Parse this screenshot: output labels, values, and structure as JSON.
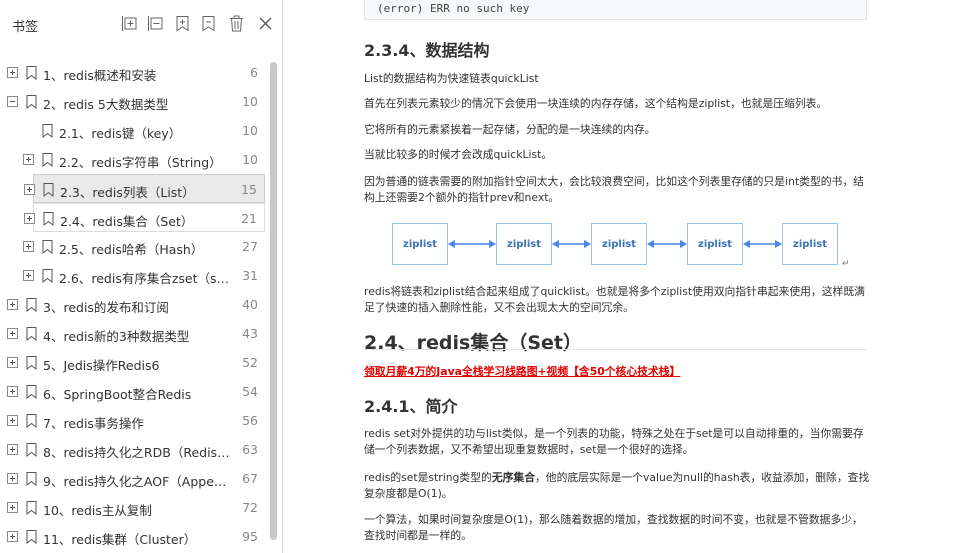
{
  "sidebar": {
    "title": "书签",
    "toolbar": {
      "expand_all": "expand-all-icon",
      "collapse_all": "collapse-all-icon",
      "add_bookmark": "add-bookmark-icon",
      "remove_bookmark": "remove-bookmark-icon",
      "delete": "trash-icon",
      "close": "close-icon"
    },
    "items": [
      {
        "label": "1、redis概述和安装",
        "page": "6",
        "expander": "plus",
        "level": 0
      },
      {
        "label": "2、redis 5大数据类型",
        "page": "10",
        "expander": "minus",
        "level": 0
      },
      {
        "label": "2.1、redis键（key）",
        "page": "10",
        "expander": "none",
        "level": 1
      },
      {
        "label": "2.2、redis字符串（String）",
        "page": "10",
        "expander": "plus",
        "level": 1
      },
      {
        "label": "2.3、redis列表（List）",
        "page": "15",
        "expander": "plus",
        "level": 1,
        "selected": true
      },
      {
        "label": "2.4、redis集合（Set）",
        "page": "21",
        "expander": "plus",
        "level": 1,
        "hover": true
      },
      {
        "label": "2.5、redis哈希（Hash）",
        "page": "27",
        "expander": "plus",
        "level": 1
      },
      {
        "label": "2.6、redis有序集合zset（sort...",
        "page": "31",
        "expander": "plus",
        "level": 1
      },
      {
        "label": "3、redis的发布和订阅",
        "page": "40",
        "expander": "plus",
        "level": 0
      },
      {
        "label": "4、redis新的3种数据类型",
        "page": "43",
        "expander": "plus",
        "level": 0
      },
      {
        "label": "5、Jedis操作Redis6",
        "page": "52",
        "expander": "plus",
        "level": 0
      },
      {
        "label": "6、SpringBoot整合Redis",
        "page": "54",
        "expander": "plus",
        "level": 0
      },
      {
        "label": "7、redis事务操作",
        "page": "56",
        "expander": "plus",
        "level": 0
      },
      {
        "label": "8、redis持久化之RDB（Redis D...",
        "page": "63",
        "expander": "plus",
        "level": 0
      },
      {
        "label": "9、redis持久化之AOF（Append ...",
        "page": "67",
        "expander": "plus",
        "level": 0
      },
      {
        "label": "10、redis主从复制",
        "page": "72",
        "expander": "plus",
        "level": 0
      },
      {
        "label": "11、redis集群（Cluster）",
        "page": "95",
        "expander": "plus",
        "level": 0
      }
    ]
  },
  "document": {
    "code_line": "(error) ERR no such key",
    "h_234": "2.3.4、数据结构",
    "p1": "List的数据结构为快速链表quickList",
    "p2": "首先在列表元素较少的情况下会使用一块连续的内存存储，这个结构是ziplist，也就是压缩列表。",
    "p3": "它将所有的元素紧挨着一起存储，分配的是一块连续的内存。",
    "p4": "当就比较多的时候才会改成quickList。",
    "p5": "因为普通的链表需要的附加指针空间太大，会比较浪费空间，比如这个列表里存储的只是int类型的书，结构上还需要2个额外的指针prev和next。",
    "diagram_nodes": [
      "ziplist",
      "ziplist",
      "ziplist",
      "ziplist",
      "ziplist"
    ],
    "return_mark": "↵",
    "p6": "redis将链表和ziplist结合起来组成了quicklist。也就是将多个ziplist使用双向指针串起来使用，这样既满足了快速的插入删除性能，又不会出现太大的空间冗余。",
    "h_24": "2.4、redis集合（Set）",
    "promo": "领取月薪4万的Java全栈学习线路图+视频【含50个核心技术栈】",
    "h_241": "2.4.1、简介",
    "p7": "redis set对外提供的功与list类似，是一个列表的功能，特殊之处在于set是可以自动排重的，当你需要存储一个列表数据，又不希望出现重复数据时，set是一个很好的选择。",
    "p8_a": "redis的set是string类型的",
    "p8_b": "无序集合",
    "p8_c": "，他的底层实际是一个value为null的hash表，收益添加，删除，查找复杂度都是O(1)。",
    "p9": "一个算法，如果时间复杂度是O(1)，那么随着数据的增加，查找数据的时间不变，也就是不管数据多少，查找时间都是一样的。"
  },
  "colors": {
    "link_red": "#e60000",
    "diagram_blue": "#3a72b8",
    "arrow_blue": "#4a86e8",
    "selected_bg": "#e9e9e9"
  }
}
